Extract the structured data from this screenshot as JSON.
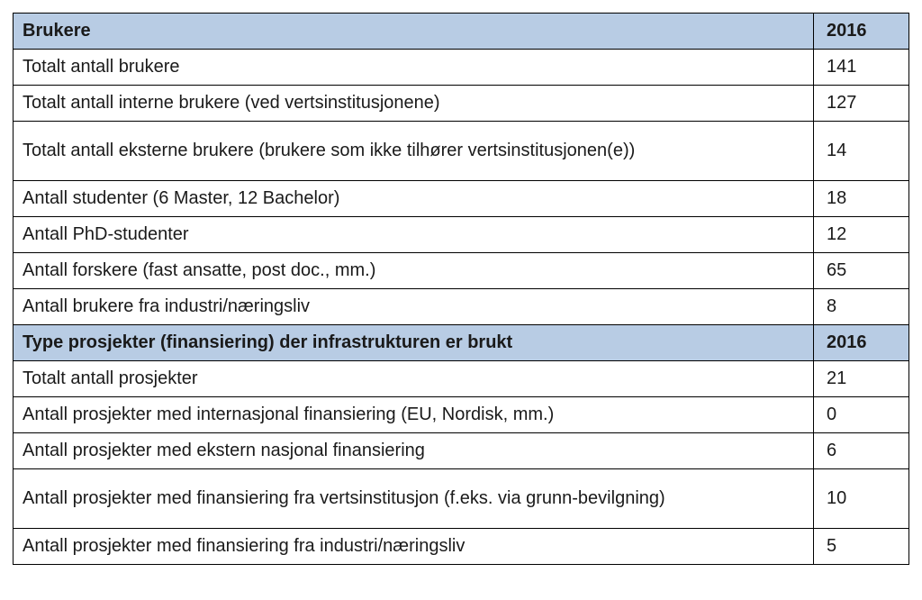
{
  "section1": {
    "header": {
      "label": "Brukere",
      "year": "2016"
    },
    "rows": [
      {
        "label": "Totalt antall brukere",
        "value": "141",
        "tall": false
      },
      {
        "label": "Totalt antall interne brukere (ved vertsinstitusjonene)",
        "value": "127",
        "tall": false
      },
      {
        "label": "Totalt antall eksterne brukere (brukere som ikke tilhører vertsinstitusjonen(e))",
        "value": "14",
        "tall": true
      },
      {
        "label": "Antall studenter (6 Master, 12 Bachelor)",
        "value": "18",
        "tall": false
      },
      {
        "label": "Antall PhD-studenter",
        "value": "12",
        "tall": false
      },
      {
        "label": "Antall forskere (fast ansatte, post doc., mm.)",
        "value": "65",
        "tall": false
      },
      {
        "label": "Antall brukere fra industri/næringsliv",
        "value": "8",
        "tall": false
      }
    ]
  },
  "section2": {
    "header": {
      "label": "Type prosjekter (finansiering) der infrastrukturen er brukt",
      "year": "2016"
    },
    "rows": [
      {
        "label": "Totalt antall prosjekter",
        "value": "21",
        "tall": false
      },
      {
        "label": "Antall prosjekter med internasjonal finansiering (EU, Nordisk, mm.)",
        "value": "0",
        "tall": false
      },
      {
        "label": "Antall prosjekter med ekstern nasjonal finansiering",
        "value": "6",
        "tall": false
      },
      {
        "label": "Antall prosjekter med finansiering fra vertsinstitusjon (f.eks. via grunn-bevilgning)",
        "value": "10",
        "tall": true
      },
      {
        "label": "Antall prosjekter med finansiering fra industri/næringsliv",
        "value": "5",
        "tall": false
      }
    ]
  },
  "chart_data": {
    "type": "table",
    "title": "Brukere og prosjekter 2016",
    "sections": [
      {
        "name": "Brukere",
        "year": 2016,
        "data": [
          {
            "metric": "Totalt antall brukere",
            "value": 141
          },
          {
            "metric": "Totalt antall interne brukere (ved vertsinstitusjonene)",
            "value": 127
          },
          {
            "metric": "Totalt antall eksterne brukere (brukere som ikke tilhører vertsinstitusjonen(e))",
            "value": 14
          },
          {
            "metric": "Antall studenter (6 Master, 12 Bachelor)",
            "value": 18
          },
          {
            "metric": "Antall PhD-studenter",
            "value": 12
          },
          {
            "metric": "Antall forskere (fast ansatte, post doc., mm.)",
            "value": 65
          },
          {
            "metric": "Antall brukere fra industri/næringsliv",
            "value": 8
          }
        ]
      },
      {
        "name": "Type prosjekter (finansiering) der infrastrukturen er brukt",
        "year": 2016,
        "data": [
          {
            "metric": "Totalt antall prosjekter",
            "value": 21
          },
          {
            "metric": "Antall prosjekter med internasjonal finansiering (EU, Nordisk, mm.)",
            "value": 0
          },
          {
            "metric": "Antall prosjekter med ekstern nasjonal finansiering",
            "value": 6
          },
          {
            "metric": "Antall prosjekter med finansiering fra vertsinstitusjon (f.eks. via grunn-bevilgning)",
            "value": 10
          },
          {
            "metric": "Antall prosjekter med finansiering fra industri/næringsliv",
            "value": 5
          }
        ]
      }
    ]
  }
}
